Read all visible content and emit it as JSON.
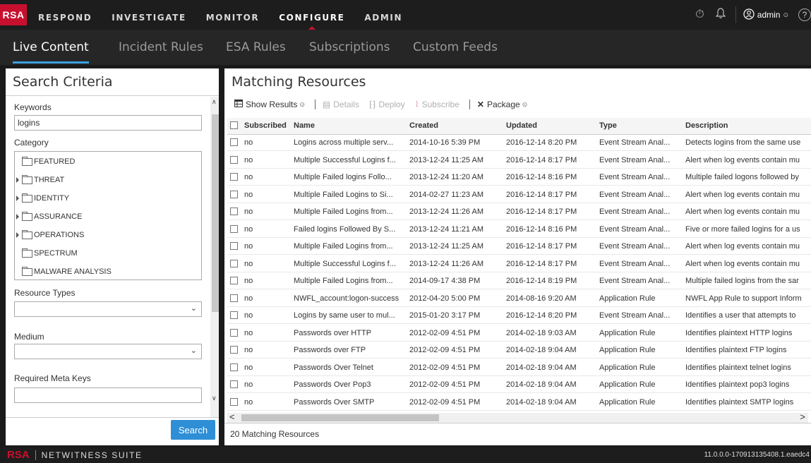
{
  "brand": {
    "logo": "RSA",
    "product": "NETWITNESS SUITE",
    "version": "11.0.0.0-170913135408.1.eaedc4"
  },
  "nav": {
    "items": [
      {
        "label": "RESPOND"
      },
      {
        "label": "INVESTIGATE"
      },
      {
        "label": "MONITOR"
      },
      {
        "label": "CONFIGURE",
        "active": true
      },
      {
        "label": "ADMIN"
      }
    ],
    "user": "admin",
    "icons": [
      "timer-icon",
      "bell-icon",
      "user-icon",
      "help-icon"
    ]
  },
  "subnav": {
    "tabs": [
      {
        "label": "Live Content",
        "active": true
      },
      {
        "label": "Incident Rules"
      },
      {
        "label": "ESA Rules"
      },
      {
        "label": "Subscriptions"
      },
      {
        "label": "Custom Feeds"
      }
    ]
  },
  "search": {
    "title": "Search Criteria",
    "keywords_label": "Keywords",
    "keywords_value": "logins",
    "category_label": "Category",
    "categories": [
      {
        "label": "FEATURED",
        "expandable": false
      },
      {
        "label": "THREAT",
        "expandable": true
      },
      {
        "label": "IDENTITY",
        "expandable": true
      },
      {
        "label": "ASSURANCE",
        "expandable": true
      },
      {
        "label": "OPERATIONS",
        "expandable": true
      },
      {
        "label": "SPECTRUM",
        "expandable": false
      },
      {
        "label": "MALWARE ANALYSIS",
        "expandable": false
      }
    ],
    "resource_types_label": "Resource Types",
    "resource_types_value": "",
    "medium_label": "Medium",
    "medium_value": "",
    "meta_keys_label": "Required Meta Keys",
    "meta_keys_value": "",
    "search_button": "Search"
  },
  "results": {
    "title": "Matching Resources",
    "toolbar": {
      "show_results": "Show Results",
      "details": "Details",
      "deploy": "Deploy",
      "subscribe": "Subscribe",
      "package": "Package"
    },
    "columns": [
      "Subscribed",
      "Name",
      "Created",
      "Updated",
      "Type",
      "Description"
    ],
    "rows": [
      [
        "no",
        "Logins across multiple serv...",
        "2014-10-16 5:39 PM",
        "2016-12-14 8:20 PM",
        "Event Stream Anal...",
        "Detects logins from the same use"
      ],
      [
        "no",
        "Multiple Successful Logins f...",
        "2013-12-24 11:25 AM",
        "2016-12-14 8:17 PM",
        "Event Stream Anal...",
        "Alert when log events contain mu"
      ],
      [
        "no",
        "Multiple Failed logins Follo...",
        "2013-12-24 11:20 AM",
        "2016-12-14 8:16 PM",
        "Event Stream Anal...",
        "Multiple failed logons followed by"
      ],
      [
        "no",
        "Multiple Failed Logins to Si...",
        "2014-02-27 11:23 AM",
        "2016-12-14 8:17 PM",
        "Event Stream Anal...",
        "Alert when log events contain mu"
      ],
      [
        "no",
        "Multiple Failed Logins from...",
        "2013-12-24 11:26 AM",
        "2016-12-14 8:17 PM",
        "Event Stream Anal...",
        "Alert when log events contain mu"
      ],
      [
        "no",
        "Failed logins Followed By S...",
        "2013-12-24 11:21 AM",
        "2016-12-14 8:16 PM",
        "Event Stream Anal...",
        "Five or more failed logins for a us"
      ],
      [
        "no",
        "Multiple Failed Logins from...",
        "2013-12-24 11:25 AM",
        "2016-12-14 8:17 PM",
        "Event Stream Anal...",
        "Alert when log events contain mu"
      ],
      [
        "no",
        "Multiple Successful Logins f...",
        "2013-12-24 11:26 AM",
        "2016-12-14 8:17 PM",
        "Event Stream Anal...",
        "Alert when log events contain mu"
      ],
      [
        "no",
        "Multiple Failed Logins from...",
        "2014-09-17 4:38 PM",
        "2016-12-14 8:19 PM",
        "Event Stream Anal...",
        "Multiple failed logins from the sar"
      ],
      [
        "no",
        "NWFL_account:logon-success",
        "2012-04-20 5:00 PM",
        "2014-08-16 9:20 AM",
        "Application Rule",
        "NWFL App Rule to support Inform"
      ],
      [
        "no",
        "Logins by same user to mul...",
        "2015-01-20 3:17 PM",
        "2016-12-14 8:20 PM",
        "Event Stream Anal...",
        "Identifies a user that attempts to"
      ],
      [
        "no",
        "Passwords over HTTP",
        "2012-02-09 4:51 PM",
        "2014-02-18 9:03 AM",
        "Application Rule",
        "Identifies plaintext HTTP logins"
      ],
      [
        "no",
        "Passwords over FTP",
        "2012-02-09 4:51 PM",
        "2014-02-18 9:04 AM",
        "Application Rule",
        "Identifies plaintext FTP logins"
      ],
      [
        "no",
        "Passwords Over Telnet",
        "2012-02-09 4:51 PM",
        "2014-02-18 9:04 AM",
        "Application Rule",
        "Identifies plaintext telnet logins"
      ],
      [
        "no",
        "Passwords Over Pop3",
        "2012-02-09 4:51 PM",
        "2014-02-18 9:04 AM",
        "Application Rule",
        "Identifies plaintext pop3 logins"
      ],
      [
        "no",
        "Passwords Over SMTP",
        "2012-02-09 4:51 PM",
        "2014-02-18 9:04 AM",
        "Application Rule",
        "Identifies plaintext SMTP logins"
      ]
    ],
    "footer": "20 Matching Resources"
  },
  "colors": {
    "brand_red": "#c8102e",
    "accent_blue": "#2f8fd6",
    "topbar": "#1d1d1d",
    "subnav": "#262626"
  }
}
